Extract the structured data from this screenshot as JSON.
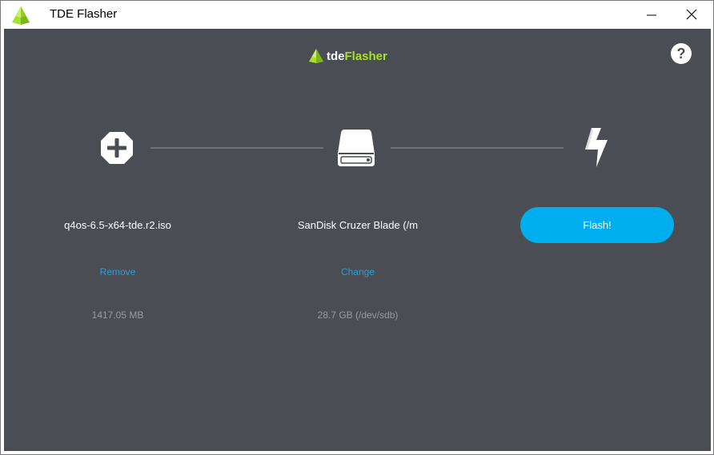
{
  "window": {
    "title": "TDE Flasher"
  },
  "header": {
    "logo_prefix": "tde",
    "logo_suffix": "Flasher",
    "help_label": "?"
  },
  "steps": {
    "image": {
      "name": "q4os-6.5-x64-tde.r2.iso",
      "action": "Remove",
      "size": "1417.05 MB"
    },
    "drive": {
      "name": "SanDisk  Cruzer Blade (/m",
      "action": "Change",
      "size": "28.7 GB (/dev/sdb)"
    },
    "flash": {
      "button_label": "Flash!"
    }
  },
  "colors": {
    "background": "#4b4d54",
    "accent_blue": "#00aeef",
    "link_blue": "#2a9fd8",
    "brand_green": "#a6e12e"
  },
  "icons": {
    "app": "tde-logo-icon",
    "minimize": "minimize-icon",
    "close": "close-icon",
    "help": "help-icon",
    "add": "add-image-icon",
    "drive": "drive-icon",
    "flash": "flash-icon"
  }
}
